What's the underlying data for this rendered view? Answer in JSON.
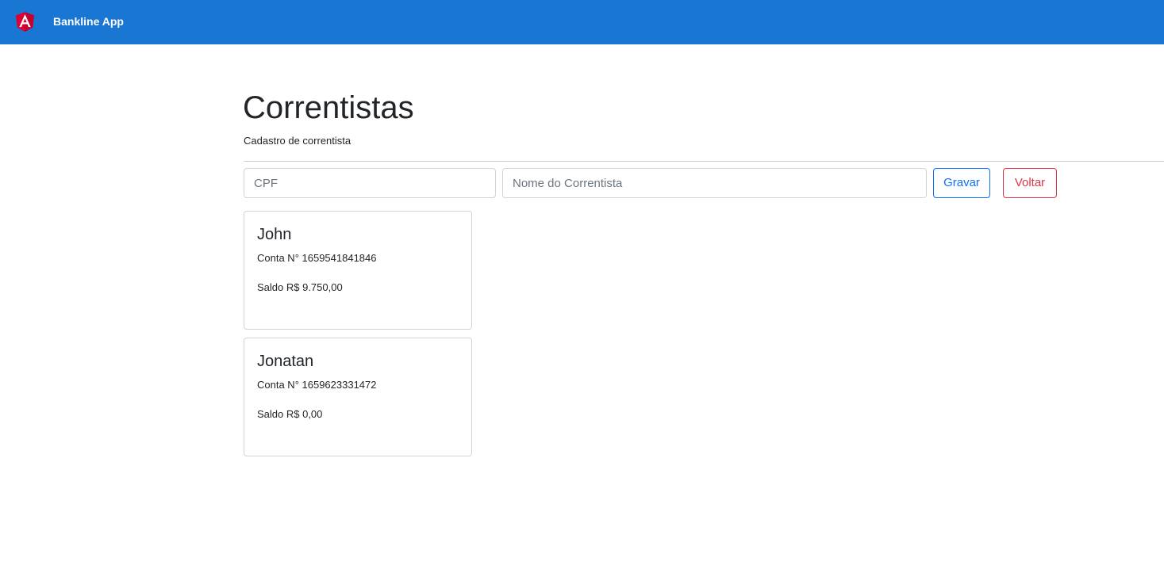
{
  "header": {
    "app_title": "Bankline App",
    "logo_icon": "angular-logo-icon",
    "background_color": "#1976d2"
  },
  "page": {
    "title": "Correntistas",
    "subtitle": "Cadastro de correntista"
  },
  "form": {
    "cpf_placeholder": "CPF",
    "cpf_value": "",
    "nome_placeholder": "Nome do Correntista",
    "nome_value": "",
    "gravar_label": "Gravar",
    "voltar_label": "Voltar",
    "gravar_color": "#0d6efd",
    "voltar_color": "#dc3545"
  },
  "correntistas": [
    {
      "name": "John",
      "conta_text": "Conta N° 1659541841846",
      "saldo_text": "Saldo R$ 9.750,00"
    },
    {
      "name": "Jonatan",
      "conta_text": "Conta N° 1659623331472",
      "saldo_text": "Saldo R$ 0,00"
    }
  ]
}
